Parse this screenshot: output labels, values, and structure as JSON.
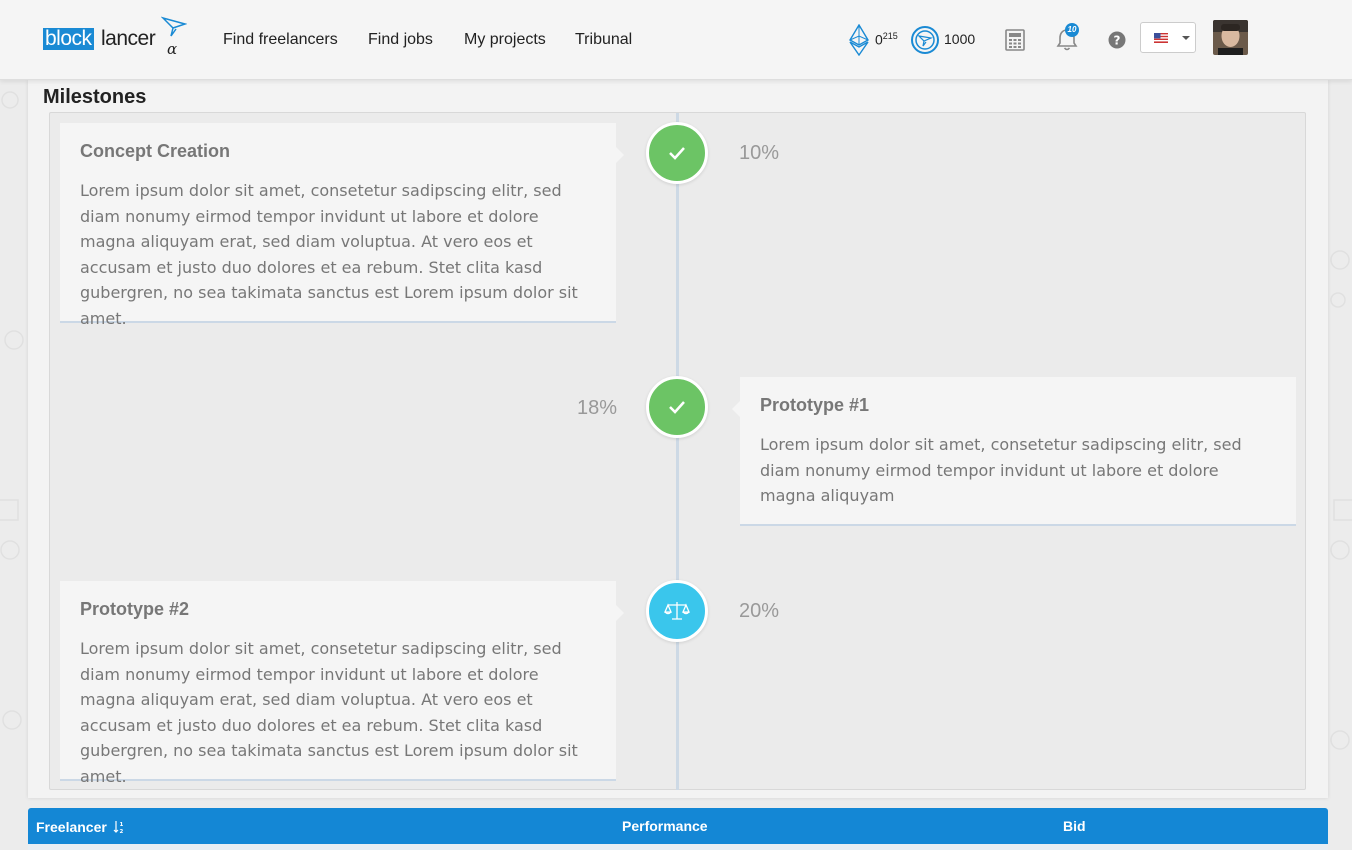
{
  "navbar": {
    "logo_block": "block",
    "logo_lancer": "lancer",
    "logo_alpha": "α",
    "links": [
      "Find freelancers",
      "Find jobs",
      "My projects",
      "Tribunal"
    ],
    "eth_balance_main": "0",
    "eth_balance_sup": "215",
    "token_balance": "1000",
    "notification_count": "10",
    "icons": [
      "ethereum-icon",
      "token-icon",
      "calculator-icon",
      "bell-icon",
      "help-icon",
      "us-flag-icon",
      "chevron-down-icon"
    ]
  },
  "milestones": {
    "title": "Milestones",
    "items": [
      {
        "title": "Concept Creation",
        "text": "Lorem ipsum dolor sit amet, consetetur sadipscing elitr, sed diam nonumy eirmod tempor invidunt ut labore et dolore magna aliquyam erat, sed diam voluptua. At vero eos et accusam et justo duo dolores et ea rebum. Stet clita kasd gubergren, no sea takimata sanctus est Lorem ipsum dolor sit amet.",
        "percent": "10%",
        "status": "completed",
        "status_icon": "check-icon"
      },
      {
        "title": "Prototype #1",
        "text": "Lorem ipsum dolor sit amet, consetetur sadipscing elitr, sed diam nonumy eirmod tempor invidunt ut labore et dolore magna aliquyam",
        "percent": "18%",
        "status": "completed",
        "status_icon": "check-icon"
      },
      {
        "title": "Prototype #2",
        "text": "Lorem ipsum dolor sit amet, consetetur sadipscing elitr, sed diam nonumy eirmod tempor invidunt ut labore et dolore magna aliquyam erat, sed diam voluptua. At vero eos et accusam et justo duo dolores et ea rebum. Stet clita kasd gubergren, no sea takimata sanctus est Lorem ipsum dolor sit amet.",
        "percent": "20%",
        "status": "dispute",
        "status_icon": "scales-icon"
      }
    ]
  },
  "table": {
    "columns": [
      "Freelancer",
      "Performance",
      "Bid"
    ],
    "sort_icon": "sort-numeric-icon"
  },
  "colors": {
    "brand_blue": "#1a8ad4",
    "header_blue": "#1487d5",
    "done_green": "#6cc465",
    "dispute_cyan": "#3ac6ec"
  }
}
